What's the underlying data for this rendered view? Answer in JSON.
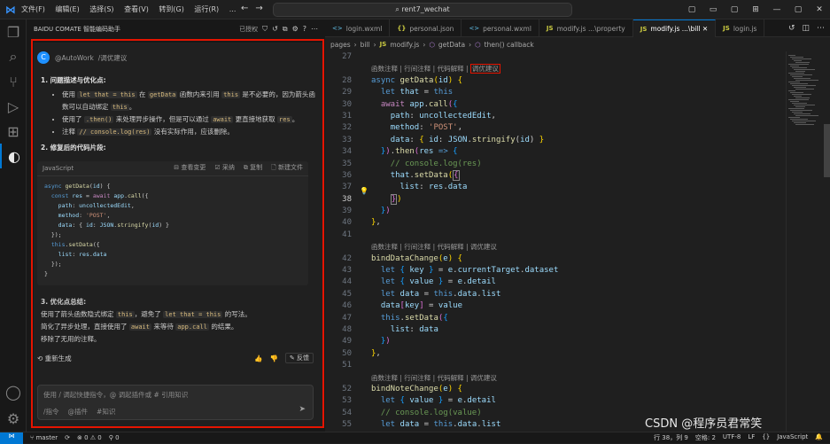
{
  "titlebar": {
    "menu": [
      "文件(F)",
      "编辑(E)",
      "选择(S)",
      "查看(V)",
      "转到(G)",
      "运行(R)",
      "..."
    ],
    "search": "rent7_wechat"
  },
  "sidebar": {
    "title": "BAIDU COMATE 智能编码助手",
    "status": "已授权"
  },
  "chat": {
    "user_name": "@AutoWork",
    "user_cmd": "/调优建议",
    "sec1_title": "1. 问题描述与优化点:",
    "b1_a": "使用 ",
    "b1_code1": "let that = this",
    "b1_b": " 在 ",
    "b1_code2": "getData",
    "b1_c": " 函数内来引用 ",
    "b1_code3": "this",
    "b1_d": " 是不必要的，因为箭头函数可以自动绑定 ",
    "b1_code4": "this",
    "b1_e": "。",
    "b2_a": "使用了 ",
    "b2_code1": ".then()",
    "b2_b": " 来处理异步操作，但是可以通过 ",
    "b2_code2": "await",
    "b2_c": " 更直接地获取 ",
    "b2_code3": "res",
    "b2_d": "。",
    "b3_a": "注释 ",
    "b3_code1": "// console.log(res)",
    "b3_b": " 没有实际作用，应该删除。",
    "sec2_title": "2. 修复后的代码片段:",
    "code_lang": "JavaScript",
    "code_actions": [
      "查看变更",
      "采纳",
      "复制",
      "新建文件"
    ],
    "code_lines": [
      "async getData(id) {",
      "  const res = await app.call({",
      "    path: uncollectedEdit,",
      "    method: 'POST',",
      "    data: { id: JSON.stringify(id) }",
      "  });",
      "  this.setData({",
      "    list: res.data",
      "  });",
      "}"
    ],
    "sec3_title": "3. 优化点总结:",
    "s1_a": "使用了箭头函数隐式绑定 ",
    "s1_code1": "this",
    "s1_b": "，避免了 ",
    "s1_code2": "let that = this",
    "s1_c": " 的写法。",
    "s2_a": "简化了异步处理，直接使用了 ",
    "s2_code1": "await",
    "s2_b": " 来等待 ",
    "s2_code2": "app.call",
    "s2_c": " 的结果。",
    "s3": "移除了无用的注释。",
    "regen": "重新生成",
    "feedback": "反馈",
    "input_placeholder": "使用 / 调起快捷指令，@ 调起插件或 # 引用知识",
    "hint_cmd": "/指令",
    "hint_plugin": "@插件",
    "hint_know": "#知识"
  },
  "tabs": [
    {
      "icon": "<>",
      "label": "login.wxml",
      "active": false
    },
    {
      "icon": "{}",
      "label": "personal.json",
      "active": false
    },
    {
      "icon": "<>",
      "label": "personal.wxml",
      "active": false
    },
    {
      "icon": "JS",
      "label": "modify.js ...\\property",
      "active": false
    },
    {
      "icon": "JS",
      "label": "modify.js ...\\bill",
      "active": true
    },
    {
      "icon": "JS",
      "label": "login.js",
      "active": false
    }
  ],
  "breadcrumb": [
    "pages",
    "bill",
    "modify.js",
    "getData",
    "then() callback"
  ],
  "editor": {
    "lens": "函数注释 | 行间注释 | 代码解释 | ",
    "lens_hl": "调优建议",
    "lens_full": "函数注释 | 行间注释 | 代码解释 | 调优建议",
    "gutter": [
      "27",
      "28",
      "29",
      "30",
      "31",
      "32",
      "33",
      "34",
      "35",
      "36",
      "37",
      "38",
      "39",
      "40",
      "41",
      "",
      "42",
      "43",
      "44",
      "45",
      "46",
      "47",
      "48",
      "49",
      "50",
      "51",
      "",
      "52",
      "53",
      "54",
      "55",
      "56"
    ]
  },
  "status": {
    "branch": "master",
    "errors": "0",
    "warnings": "0",
    "ports": "0",
    "position": "行 38，列 9",
    "spaces": "空格: 2",
    "encoding": "UTF-8",
    "eol": "LF",
    "braces": "{}",
    "language": "JavaScript"
  },
  "watermark": "CSDN @程序员君常笑"
}
